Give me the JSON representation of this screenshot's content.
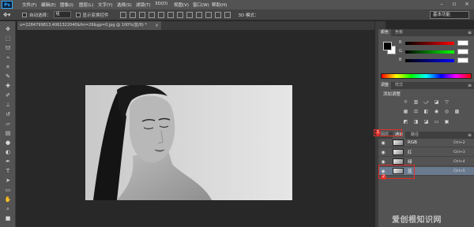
{
  "app": {
    "logo": "Ps",
    "menus": [
      "文件(F)",
      "编辑(E)",
      "图像(I)",
      "图层(L)",
      "文字(Y)",
      "选择(S)",
      "滤镜(T)",
      "3D(D)",
      "视图(V)",
      "窗口(W)",
      "帮助(H)"
    ],
    "window_controls": [
      "minimize-icon",
      "restore-icon",
      "close-icon"
    ]
  },
  "options_bar": {
    "auto_select_label": "自动选择：",
    "auto_select_value": "组",
    "show_transform_label": "显示变换控件",
    "mode_3d_label": "3D 模式：",
    "workspace": "基本功能"
  },
  "document": {
    "tab_title": "u=2284799813,4061322040&fm=26&gp=0.jpg @ 100%(蓝/8) *",
    "close_glyph": "×"
  },
  "color_panel": {
    "tabs": [
      "颜色",
      "色板"
    ],
    "sliders": [
      {
        "label": "R",
        "value": ""
      },
      {
        "label": "G",
        "value": ""
      },
      {
        "label": "B",
        "value": ""
      }
    ],
    "accent_colors": {
      "red": "#e0302a",
      "spectrum": "rainbow"
    }
  },
  "adjust_panel": {
    "tabs": [
      "调整",
      "样式"
    ],
    "title": "添加调整"
  },
  "channels_panel": {
    "tabs": [
      "图层",
      "通道",
      "路径"
    ],
    "rows": [
      {
        "name": "RGB",
        "shortcut": "Ctrl+2",
        "selected": false
      },
      {
        "name": "红",
        "shortcut": "Ctrl+3",
        "selected": false
      },
      {
        "name": "绿",
        "shortcut": "Ctrl+4",
        "selected": false
      },
      {
        "name": "蓝",
        "shortcut": "Ctrl+5",
        "selected": true
      }
    ],
    "annotations": [
      "1",
      "2"
    ]
  },
  "watermark": "爱创根知识网"
}
